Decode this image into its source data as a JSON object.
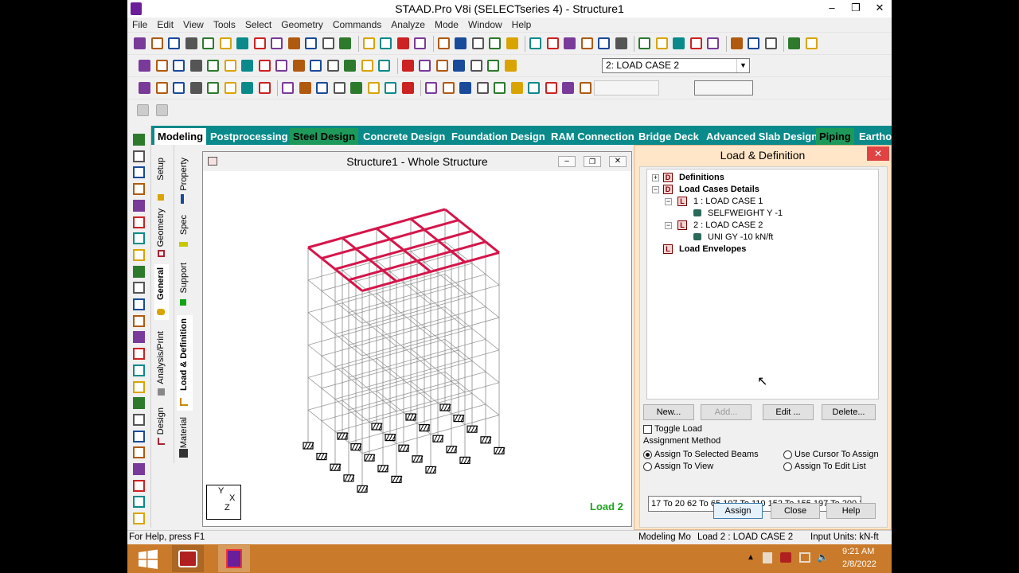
{
  "window": {
    "title": "STAAD.Pro V8i (SELECTseries 4) - Structure1"
  },
  "menu": [
    "File",
    "Edit",
    "View",
    "Tools",
    "Select",
    "Geometry",
    "Commands",
    "Analyze",
    "Mode",
    "Window",
    "Help"
  ],
  "toolbar": {
    "load_case_selected": "2: LOAD CASE 2"
  },
  "main_tabs": [
    "Modeling",
    "Postprocessing",
    "Steel Design",
    "Concrete Design",
    "Foundation Design",
    "RAM Connection",
    "Bridge Deck",
    "Advanced Slab Design",
    "Piping",
    "Eartho"
  ],
  "outer_vtabs": [
    "Setup",
    "Geometry",
    "General",
    "Analysis/Print",
    "Design"
  ],
  "inner_vtabs": [
    "Property",
    "Spec",
    "Support",
    "Load & Definition",
    "Material"
  ],
  "structure_window": {
    "title": "Structure1 - Whole Structure",
    "load_label": "Load 2",
    "axis_y": "Y",
    "axis_x": "X",
    "axis_z": "Z"
  },
  "load_panel": {
    "title": "Load & Definition",
    "tree": {
      "definitions": "Definitions",
      "load_cases_details": "Load Cases Details",
      "case1": "1 : LOAD CASE 1",
      "case1_item": "SELFWEIGHT Y -1",
      "case2": "2 : LOAD CASE 2",
      "case2_item": "UNI GY -10 kN/ft",
      "load_envelopes": "Load Envelopes"
    },
    "buttons": {
      "new": "New...",
      "add": "Add...",
      "edit": "Edit ...",
      "delete": "Delete...",
      "assign": "Assign",
      "close": "Close",
      "help": "Help"
    },
    "toggle_load": "Toggle Load",
    "assignment_method": "Assignment Method",
    "radio": {
      "selected_beams": "Assign To Selected Beams",
      "view": "Assign To View",
      "cursor": "Use Cursor To Assign",
      "edit_list": "Assign To Edit List"
    },
    "beams_list": "17 To 20 62 To 65 107 To 110 152 To 155 197 To 200 24"
  },
  "status": {
    "help": "For Help, press F1",
    "mode": "Modeling Mo",
    "load": "Load 2 : LOAD CASE 2",
    "units": "Input Units:  kN-ft"
  },
  "taskbar": {
    "time": "9:21 AM",
    "date": "2/8/2022"
  },
  "colors": {
    "tab_strip": "#0a8a8a",
    "roof_beams": "#d6154a",
    "taskbar": "#c97a2a",
    "load_label": "#1aa51a"
  }
}
